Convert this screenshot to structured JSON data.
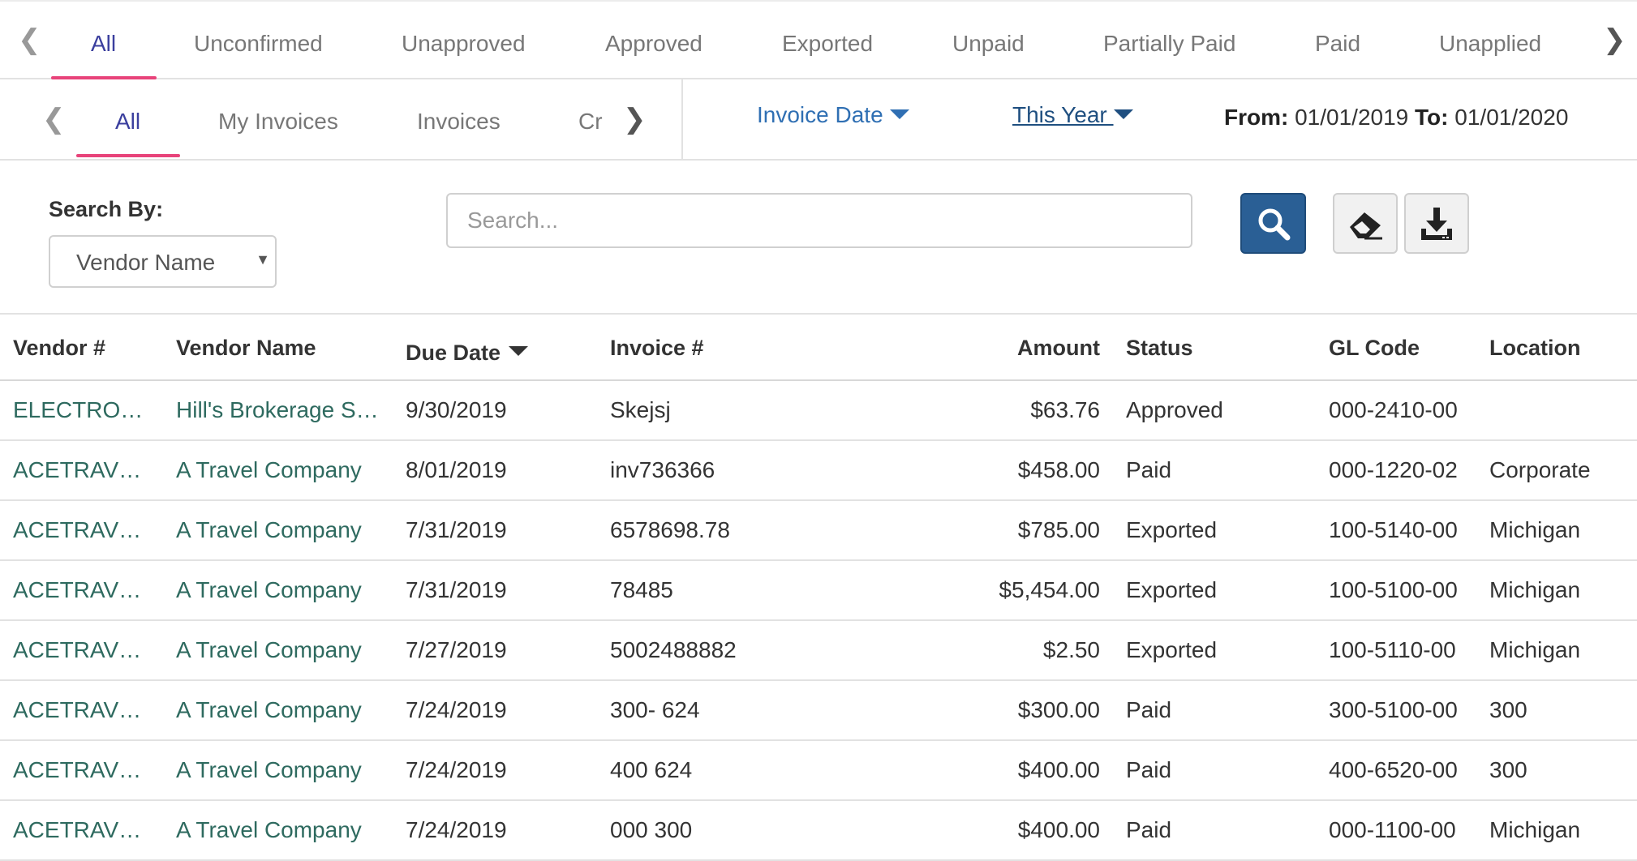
{
  "status_tabs": {
    "items": [
      "All",
      "Unconfirmed",
      "Unapproved",
      "Approved",
      "Exported",
      "Unpaid",
      "Partially Paid",
      "Paid",
      "Unapplied"
    ],
    "active": "All",
    "prev_icon": "chevron-left-icon",
    "next_icon": "chevron-right-icon"
  },
  "type_tabs": {
    "items": [
      "All",
      "My Invoices",
      "Invoices",
      "Cr"
    ],
    "active": "All",
    "prev_icon": "chevron-left-icon",
    "next_icon": "chevron-right-icon"
  },
  "date_filter": {
    "field_label": "Invoice Date",
    "period_label": "This Year ",
    "from_label": "From:",
    "from_value": "01/01/2019",
    "to_label": "To:",
    "to_value": "01/01/2020"
  },
  "search": {
    "by_label": "Search By:",
    "by_value": "Vendor Name",
    "placeholder": "Search...",
    "search_icon": "search-icon",
    "clear_icon": "eraser-icon",
    "download_icon": "download-icon"
  },
  "table": {
    "columns": [
      "Vendor #",
      "Vendor Name",
      "Due Date",
      "Invoice #",
      "Amount",
      "Status",
      "GL Code",
      "Location"
    ],
    "rows": [
      {
        "vendor_no": "ELECTRO…",
        "vendor_name": "Hill's Brokerage S…",
        "due_date": "9/30/2019",
        "invoice_no": "Skejsj",
        "amount": "$63.76",
        "status": "Approved",
        "gl_code": "000-2410-00",
        "location": ""
      },
      {
        "vendor_no": "ACETRAV…",
        "vendor_name": "A Travel Company",
        "due_date": "8/01/2019",
        "invoice_no": "inv736366",
        "amount": "$458.00",
        "status": "Paid",
        "gl_code": "000-1220-02",
        "location": "Corporate"
      },
      {
        "vendor_no": "ACETRAV…",
        "vendor_name": "A Travel Company",
        "due_date": "7/31/2019",
        "invoice_no": "6578698.78",
        "amount": "$785.00",
        "status": "Exported",
        "gl_code": "100-5140-00",
        "location": "Michigan"
      },
      {
        "vendor_no": "ACETRAV…",
        "vendor_name": "A Travel Company",
        "due_date": "7/31/2019",
        "invoice_no": "78485",
        "amount": "$5,454.00",
        "status": "Exported",
        "gl_code": "100-5100-00",
        "location": "Michigan"
      },
      {
        "vendor_no": "ACETRAV…",
        "vendor_name": "A Travel Company",
        "due_date": "7/27/2019",
        "invoice_no": "5002488882",
        "amount": "$2.50",
        "status": "Exported",
        "gl_code": "100-5110-00",
        "location": "Michigan"
      },
      {
        "vendor_no": "ACETRAV…",
        "vendor_name": "A Travel Company",
        "due_date": "7/24/2019",
        "invoice_no": "300- 624",
        "amount": "$300.00",
        "status": "Paid",
        "gl_code": "300-5100-00",
        "location": "300"
      },
      {
        "vendor_no": "ACETRAV…",
        "vendor_name": "A Travel Company",
        "due_date": "7/24/2019",
        "invoice_no": "400 624",
        "amount": "$400.00",
        "status": "Paid",
        "gl_code": "400-6520-00",
        "location": "300"
      },
      {
        "vendor_no": "ACETRAV…",
        "vendor_name": "A Travel Company",
        "due_date": "7/24/2019",
        "invoice_no": "000 300",
        "amount": "$400.00",
        "status": "Paid",
        "gl_code": "000-1100-00",
        "location": "Michigan"
      }
    ]
  },
  "colors": {
    "accent_underline": "#e8437a",
    "active_tab": "#3b3f9e",
    "link": "#2e6a5f",
    "filter_link": "#2f6fb3",
    "primary_button": "#2a5f95"
  }
}
